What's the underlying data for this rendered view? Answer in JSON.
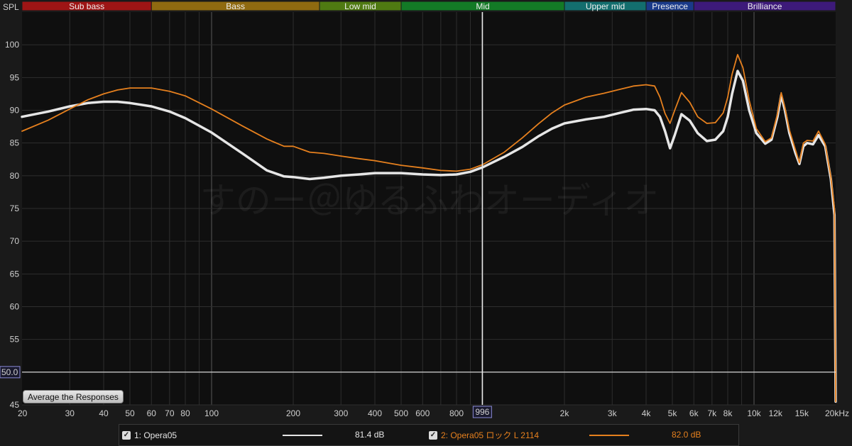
{
  "header": {
    "axis_label": "SPL"
  },
  "bands": [
    {
      "label": "Sub bass",
      "from": 20,
      "to": 60,
      "color": "#9e1515"
    },
    {
      "label": "Bass",
      "from": 60,
      "to": 250,
      "color": "#8f6a10"
    },
    {
      "label": "Low mid",
      "from": 250,
      "to": 500,
      "color": "#4f7a12"
    },
    {
      "label": "Mid",
      "from": 500,
      "to": 2000,
      "color": "#137a26"
    },
    {
      "label": "Upper mid",
      "from": 2000,
      "to": 4000,
      "color": "#136e6e"
    },
    {
      "label": "Presence",
      "from": 4000,
      "to": 6000,
      "color": "#1a3a8a"
    },
    {
      "label": "Brilliance",
      "from": 6000,
      "to": 20000,
      "color": "#3d1a7a"
    }
  ],
  "watermark": "すのー＠ゆるふわオーディオ",
  "buttons": {
    "average": "Average the Responses"
  },
  "cursor": {
    "freq": 996,
    "freq_label": "996",
    "level_label": "50.0"
  },
  "legend": {
    "item1": {
      "label": "1: Opera05",
      "value": "81.4 dB",
      "color": "#e6e6e6"
    },
    "item2": {
      "label": "2: Opera05 ロック L 2114",
      "value": "82.0 dB",
      "color": "#e6801e"
    }
  },
  "chart_data": {
    "type": "line",
    "xscale": "log",
    "xlim": [
      20,
      20000
    ],
    "ylim": [
      45,
      105
    ],
    "yticks": [
      45,
      50,
      55,
      60,
      65,
      70,
      75,
      80,
      85,
      90,
      95,
      100
    ],
    "xticks": [
      {
        "v": 20,
        "t": "20"
      },
      {
        "v": 30,
        "t": "30"
      },
      {
        "v": 40,
        "t": "40"
      },
      {
        "v": 50,
        "t": "50"
      },
      {
        "v": 60,
        "t": "60"
      },
      {
        "v": 70,
        "t": "70"
      },
      {
        "v": 80,
        "t": "80"
      },
      {
        "v": 100,
        "t": "100"
      },
      {
        "v": 200,
        "t": "200"
      },
      {
        "v": 300,
        "t": "300"
      },
      {
        "v": 400,
        "t": "400"
      },
      {
        "v": 500,
        "t": "500"
      },
      {
        "v": 600,
        "t": "600"
      },
      {
        "v": 800,
        "t": "800"
      },
      {
        "v": 2000,
        "t": "2k"
      },
      {
        "v": 3000,
        "t": "3k"
      },
      {
        "v": 4000,
        "t": "4k"
      },
      {
        "v": 5000,
        "t": "5k"
      },
      {
        "v": 6000,
        "t": "6k"
      },
      {
        "v": 7000,
        "t": "7k"
      },
      {
        "v": 8000,
        "t": "8k"
      },
      {
        "v": 10000,
        "t": "10k"
      },
      {
        "v": 12000,
        "t": "12k"
      },
      {
        "v": 15000,
        "t": "15k"
      },
      {
        "v": 20000,
        "t": "20kHz"
      }
    ],
    "series": [
      {
        "name": "1: Opera05",
        "color": "#e6e6e6",
        "points": [
          [
            20,
            89.0
          ],
          [
            25,
            89.8
          ],
          [
            30,
            90.6
          ],
          [
            35,
            91.1
          ],
          [
            40,
            91.3
          ],
          [
            45,
            91.3
          ],
          [
            50,
            91.1
          ],
          [
            60,
            90.6
          ],
          [
            70,
            89.8
          ],
          [
            80,
            88.8
          ],
          [
            100,
            86.6
          ],
          [
            130,
            83.4
          ],
          [
            160,
            80.8
          ],
          [
            185,
            79.9
          ],
          [
            200,
            79.8
          ],
          [
            230,
            79.5
          ],
          [
            260,
            79.7
          ],
          [
            300,
            80.0
          ],
          [
            350,
            80.2
          ],
          [
            400,
            80.4
          ],
          [
            500,
            80.4
          ],
          [
            600,
            80.2
          ],
          [
            700,
            80.1
          ],
          [
            800,
            80.2
          ],
          [
            900,
            80.6
          ],
          [
            1000,
            81.3
          ],
          [
            1200,
            82.9
          ],
          [
            1400,
            84.4
          ],
          [
            1600,
            86.0
          ],
          [
            1800,
            87.2
          ],
          [
            2000,
            88.0
          ],
          [
            2400,
            88.6
          ],
          [
            2800,
            89.0
          ],
          [
            3200,
            89.6
          ],
          [
            3600,
            90.1
          ],
          [
            4000,
            90.2
          ],
          [
            4300,
            90.0
          ],
          [
            4500,
            89.0
          ],
          [
            4700,
            86.8
          ],
          [
            4900,
            84.2
          ],
          [
            5100,
            86.2
          ],
          [
            5400,
            89.4
          ],
          [
            5800,
            88.4
          ],
          [
            6200,
            86.5
          ],
          [
            6700,
            85.3
          ],
          [
            7200,
            85.5
          ],
          [
            7700,
            86.8
          ],
          [
            8000,
            89.0
          ],
          [
            8300,
            92.5
          ],
          [
            8700,
            96.0
          ],
          [
            9100,
            94.5
          ],
          [
            9600,
            90.0
          ],
          [
            10200,
            86.5
          ],
          [
            11000,
            84.9
          ],
          [
            11600,
            85.5
          ],
          [
            12200,
            89.0
          ],
          [
            12600,
            92.3
          ],
          [
            13000,
            90.0
          ],
          [
            13500,
            86.5
          ],
          [
            14200,
            83.5
          ],
          [
            14700,
            81.8
          ],
          [
            15200,
            84.5
          ],
          [
            15700,
            85.0
          ],
          [
            16500,
            84.8
          ],
          [
            17300,
            86.2
          ],
          [
            18300,
            84.5
          ],
          [
            19200,
            79.5
          ],
          [
            19800,
            74.0
          ],
          [
            20000,
            45.5
          ]
        ]
      },
      {
        "name": "2: Opera05 ロック L 2114",
        "color": "#e6801e",
        "points": [
          [
            20,
            86.8
          ],
          [
            25,
            88.5
          ],
          [
            30,
            90.2
          ],
          [
            35,
            91.6
          ],
          [
            40,
            92.5
          ],
          [
            45,
            93.1
          ],
          [
            50,
            93.4
          ],
          [
            60,
            93.4
          ],
          [
            70,
            92.9
          ],
          [
            80,
            92.2
          ],
          [
            100,
            90.2
          ],
          [
            130,
            87.6
          ],
          [
            160,
            85.6
          ],
          [
            185,
            84.5
          ],
          [
            200,
            84.5
          ],
          [
            230,
            83.6
          ],
          [
            260,
            83.4
          ],
          [
            300,
            83.0
          ],
          [
            350,
            82.6
          ],
          [
            400,
            82.3
          ],
          [
            500,
            81.6
          ],
          [
            600,
            81.2
          ],
          [
            700,
            80.8
          ],
          [
            800,
            80.7
          ],
          [
            900,
            81.0
          ],
          [
            1000,
            81.7
          ],
          [
            1200,
            83.6
          ],
          [
            1400,
            85.8
          ],
          [
            1600,
            87.9
          ],
          [
            1800,
            89.6
          ],
          [
            2000,
            90.8
          ],
          [
            2400,
            92.0
          ],
          [
            2800,
            92.6
          ],
          [
            3200,
            93.2
          ],
          [
            3600,
            93.7
          ],
          [
            4000,
            93.9
          ],
          [
            4300,
            93.7
          ],
          [
            4500,
            92.0
          ],
          [
            4700,
            89.5
          ],
          [
            4900,
            88.0
          ],
          [
            5100,
            90.0
          ],
          [
            5400,
            92.7
          ],
          [
            5800,
            91.2
          ],
          [
            6200,
            89.0
          ],
          [
            6700,
            88.0
          ],
          [
            7200,
            88.1
          ],
          [
            7700,
            89.6
          ],
          [
            8000,
            92.0
          ],
          [
            8300,
            95.5
          ],
          [
            8700,
            98.5
          ],
          [
            9100,
            96.5
          ],
          [
            9600,
            91.5
          ],
          [
            10200,
            87.2
          ],
          [
            11000,
            85.2
          ],
          [
            11600,
            85.8
          ],
          [
            12200,
            89.4
          ],
          [
            12600,
            92.7
          ],
          [
            13000,
            90.4
          ],
          [
            13500,
            87.0
          ],
          [
            14200,
            84.0
          ],
          [
            14700,
            82.0
          ],
          [
            15200,
            85.0
          ],
          [
            15700,
            85.4
          ],
          [
            16500,
            85.3
          ],
          [
            17300,
            86.8
          ],
          [
            18300,
            84.8
          ],
          [
            19200,
            79.8
          ],
          [
            19800,
            75.0
          ],
          [
            20000,
            45.5
          ]
        ]
      }
    ]
  }
}
